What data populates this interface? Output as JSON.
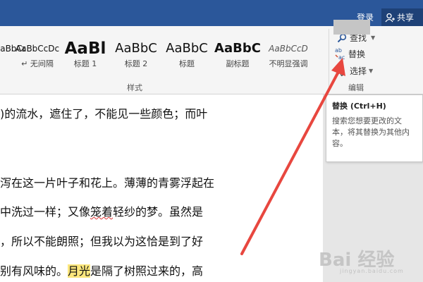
{
  "topbar": {
    "signin_label": "登录",
    "share_label": "共享",
    "color": "#2b579a"
  },
  "styles": {
    "group_label": "样式",
    "items": [
      {
        "preview": "AaBbCcDc",
        "name": ""
      },
      {
        "preview": "AaBbCcDc",
        "name": "↵ 无间隔"
      },
      {
        "preview": "AaBl",
        "name": "标题 1"
      },
      {
        "preview": "AaBbC",
        "name": "标题 2"
      },
      {
        "preview": "AaBbC",
        "name": "标题"
      },
      {
        "preview": "AaBbC",
        "name": "副标题"
      },
      {
        "preview": "AaBbCcD",
        "name": "不明显强调"
      }
    ]
  },
  "editing": {
    "group_label": "编辑",
    "find_label": "查找",
    "replace_label": "替换",
    "select_label": "选择"
  },
  "tooltip": {
    "title": "替换 (Ctrl+H)",
    "body": "搜索您想要更改的文本，将其替换为其他内容。"
  },
  "document": {
    "line1": ")的流水，遮住了，不能见一些颜色；而叶",
    "line2": "泻在这一片叶子和花上。薄薄的青雾浮起在",
    "line3_a": "中洗过一样；又像",
    "line3_squiggle": "笼着",
    "line3_b": "轻纱的梦。虽然是",
    "line4": "，所以不能朗照；但我以为这恰是到了好",
    "line5_a": "别有风味的。",
    "line5_hl": "月光",
    "line5_b": "是隔了树照过来的，高"
  },
  "watermark": {
    "text": "Bai 经验",
    "sub": "jingyan.baidu.com"
  },
  "colors": {
    "highlight": "#fce77d",
    "arrow": "#e8473f",
    "accent": "#2b579a"
  }
}
